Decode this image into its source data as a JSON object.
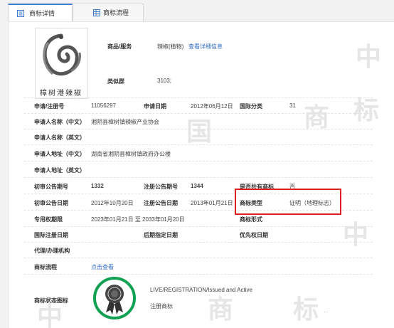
{
  "tabs": [
    {
      "label": "商标详情",
      "icon": "document-list-icon"
    },
    {
      "label": "商标流程",
      "icon": "grid-icon"
    }
  ],
  "watermark": [
    "中",
    "国",
    "商",
    "标"
  ],
  "goods": {
    "label": "商品/服务",
    "value": "辣椒(植物)",
    "link": "查看详细信息"
  },
  "similar_group": {
    "label": "类似群",
    "value": "3103;"
  },
  "application_no": {
    "label": "申请/注册号",
    "value": "11056297"
  },
  "application_date": {
    "label": "申请日期",
    "value": "2012年06月12日"
  },
  "intl_class": {
    "label": "国际分类",
    "value": "31"
  },
  "applicant_name_cn": {
    "label": "申请人名称（中文）",
    "value": "湘阴县樟树镇辣椒产业协会"
  },
  "applicant_name_en": {
    "label": "申请人名称（英文）",
    "value": ""
  },
  "applicant_addr_cn": {
    "label": "申请人地址（中文）",
    "value": "湖南省湘阴县樟树镇政府办公楼"
  },
  "applicant_addr_en": {
    "label": "申请人地址（英文）",
    "value": ""
  },
  "prelim_pub_no": {
    "label": "初审公告期号",
    "value": "1332"
  },
  "reg_pub_no": {
    "label": "注册公告期号",
    "value": "1344"
  },
  "shared": {
    "label": "是否共有商标",
    "value": "否"
  },
  "prelim_pub_date": {
    "label": "初审公告日期",
    "value": "2012年10月20日"
  },
  "reg_pub_date": {
    "label": "注册公告日期",
    "value": "2013年01月21日"
  },
  "tm_type": {
    "label": "商标类型",
    "value": "证明（地理标志）"
  },
  "exclusive_period": {
    "label": "专用权期限",
    "value": "2023年01月21日 至 2033年01月20日"
  },
  "tm_form": {
    "label": "商标形式",
    "value": ""
  },
  "intl_reg_date": {
    "label": "国际注册日期",
    "value": ""
  },
  "later_designation": {
    "label": "后期指定日期",
    "value": ""
  },
  "priority_date": {
    "label": "优先权日期",
    "value": ""
  },
  "agent": {
    "label": "代理/办理机构",
    "value": ""
  },
  "process": {
    "label": "商标流程",
    "link": "点击查看"
  },
  "status": {
    "label": "商标状态图标",
    "line1": "LIVE/REGISTRATION/Issued and Active",
    "line2": "注册商标"
  },
  "logo_text": "樟树港辣椒",
  "colors": {
    "accent": "#3d7cc9",
    "link": "#2f6ac4",
    "highlight": "#e02020",
    "status_green": "#12a152",
    "arrow": "#f0960f"
  }
}
